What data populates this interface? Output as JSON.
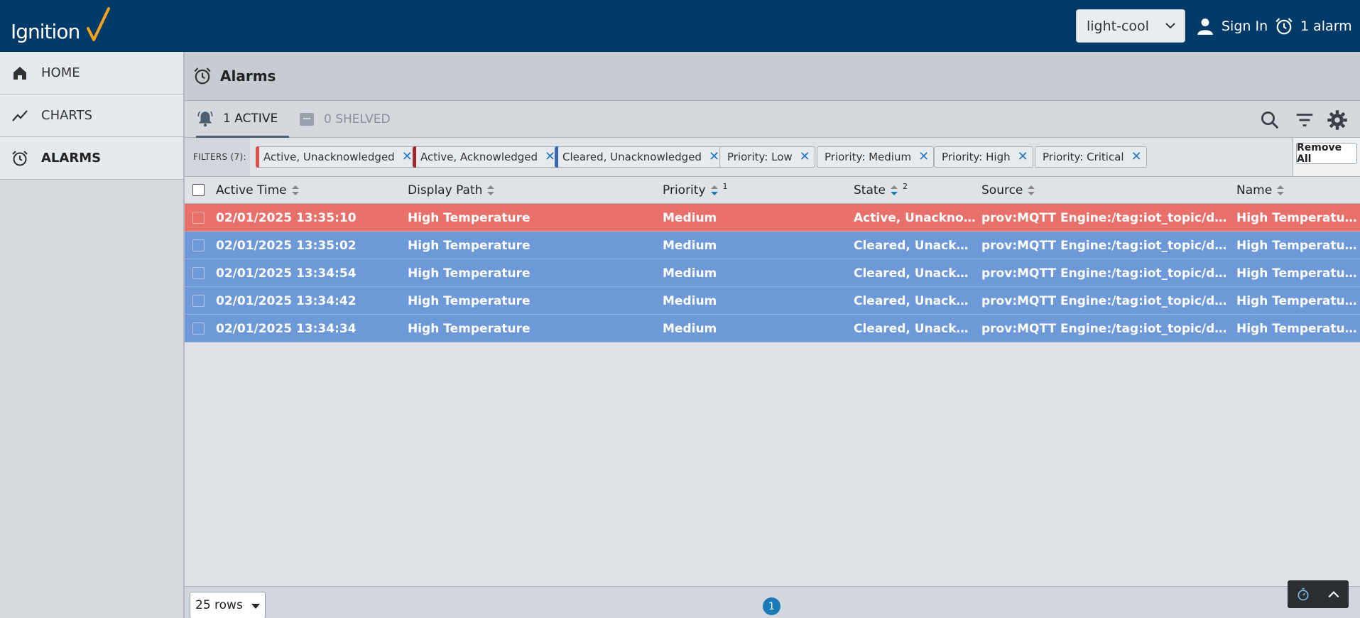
{
  "header": {
    "logo_text": "Ignition",
    "theme_select_value": "light-cool",
    "signin_label": "Sign In",
    "alarm_indicator_label": "1 alarm"
  },
  "sidebar": {
    "items": [
      {
        "label": "HOME",
        "icon": "home-icon"
      },
      {
        "label": "CHARTS",
        "icon": "chart-line-icon"
      },
      {
        "label": "ALARMS",
        "icon": "alarm-clock-icon",
        "active": true
      }
    ]
  },
  "page": {
    "title": "Alarms"
  },
  "tabs": {
    "active_label": "1 ACTIVE",
    "shelved_label": "0 SHELVED"
  },
  "filters": {
    "label": "FILTERS (7):",
    "chips": [
      {
        "label": "Active, Unacknowledged",
        "bar_color": "#d9534f"
      },
      {
        "label": "Active, Acknowledged",
        "bar_color": "#a0282c"
      },
      {
        "label": "Cleared, Unacknowledged",
        "bar_color": "#3b67b8"
      },
      {
        "label": "Priority: Low"
      },
      {
        "label": "Priority: Medium"
      },
      {
        "label": "Priority: High"
      },
      {
        "label": "Priority: Critical"
      }
    ],
    "remove_all_label": "Remove All"
  },
  "table": {
    "columns": [
      {
        "label": "Active Time",
        "sort_index": ""
      },
      {
        "label": "Display Path",
        "sort_index": ""
      },
      {
        "label": "Priority",
        "sort_index": "1"
      },
      {
        "label": "State",
        "sort_index": "2"
      },
      {
        "label": "Source",
        "sort_index": ""
      },
      {
        "label": "Name",
        "sort_index": ""
      }
    ],
    "rows": [
      {
        "active_time": "02/01/2025 13:35:10",
        "display_path": "High Temperature",
        "priority": "Medium",
        "state": "Active, Unacknowl...",
        "source": "prov:MQTT Engine:/tag:iot_topic/data/t...",
        "name": "High Temperature...",
        "kind": "active"
      },
      {
        "active_time": "02/01/2025 13:35:02",
        "display_path": "High Temperature",
        "priority": "Medium",
        "state": "Cleared, Unackno...",
        "source": "prov:MQTT Engine:/tag:iot_topic/data/t...",
        "name": "High Temperature...",
        "kind": "cleared"
      },
      {
        "active_time": "02/01/2025 13:34:54",
        "display_path": "High Temperature",
        "priority": "Medium",
        "state": "Cleared, Unackno...",
        "source": "prov:MQTT Engine:/tag:iot_topic/data/t...",
        "name": "High Temperature...",
        "kind": "cleared"
      },
      {
        "active_time": "02/01/2025 13:34:42",
        "display_path": "High Temperature",
        "priority": "Medium",
        "state": "Cleared, Unackno...",
        "source": "prov:MQTT Engine:/tag:iot_topic/data/t...",
        "name": "High Temperature...",
        "kind": "cleared"
      },
      {
        "active_time": "02/01/2025 13:34:34",
        "display_path": "High Temperature",
        "priority": "Medium",
        "state": "Cleared, Unackno...",
        "source": "prov:MQTT Engine:/tag:iot_topic/data/t...",
        "name": "High Temperature...",
        "kind": "cleared"
      }
    ]
  },
  "footer": {
    "rows_select_value": "25 rows",
    "current_page": "1"
  },
  "colors": {
    "header_bg": "#003a68",
    "active_row": "#e8706b",
    "cleared_row": "#6d99d8",
    "accent_blue": "#2778c4",
    "logo_accent": "#f7a21b"
  }
}
